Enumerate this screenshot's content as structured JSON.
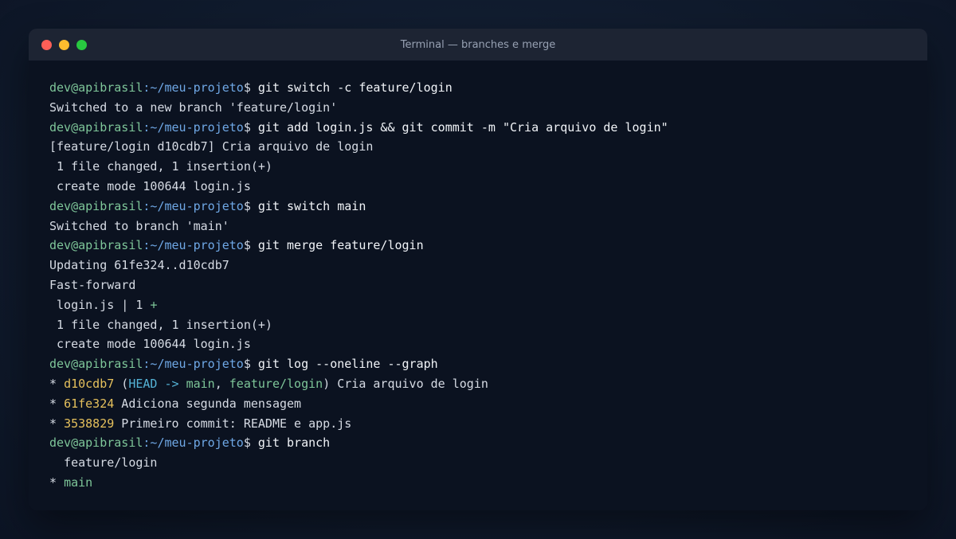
{
  "window": {
    "title": "Terminal — branches e merge"
  },
  "prompt": {
    "user": "dev@apibrasil",
    "path": ":~/meu-projeto",
    "symbol": "$"
  },
  "commands": {
    "c1": " git switch -c feature/login",
    "c2": " git add login.js && git commit -m \"Cria arquivo de login\"",
    "c3": " git switch main",
    "c4": " git merge feature/login",
    "c5": " git log --oneline --graph",
    "c6": " git branch"
  },
  "output": {
    "o1": "Switched to a new branch 'feature/login'",
    "o2": "[feature/login d10cdb7] Cria arquivo de login",
    "o3": " 1 file changed, 1 insertion(+)",
    "o4": " create mode 100644 login.js",
    "o5": "Switched to branch 'main'",
    "o6": "Updating 61fe324..d10cdb7",
    "o7": "Fast-forward",
    "o8_pre": " login.js | 1 ",
    "o8_plus": "+",
    "o9": " 1 file changed, 1 insertion(+)",
    "o10": " create mode 100644 login.js"
  },
  "log": [
    {
      "star": "* ",
      "hash": "d10cdb7",
      "open": " (",
      "head": "HEAD -> ",
      "main": "main",
      "sep": ", ",
      "branch": "feature/login",
      "close": ")",
      "msg": " Cria arquivo de login"
    },
    {
      "star": "* ",
      "hash": "61fe324",
      "msg": " Adiciona segunda mensagem"
    },
    {
      "star": "* ",
      "hash": "3538829",
      "msg": " Primeiro commit: README e app.js"
    }
  ],
  "branches": {
    "other": "  feature/login",
    "current_star": "* ",
    "current": "main"
  },
  "colors": {
    "user": "#7ec699",
    "path": "#6fa8e6",
    "hash": "#e5c05c",
    "head_ref": "#55b3d6",
    "branch_ref": "#7ec699",
    "background": "#0b1220",
    "titlebar": "#1d2433"
  }
}
